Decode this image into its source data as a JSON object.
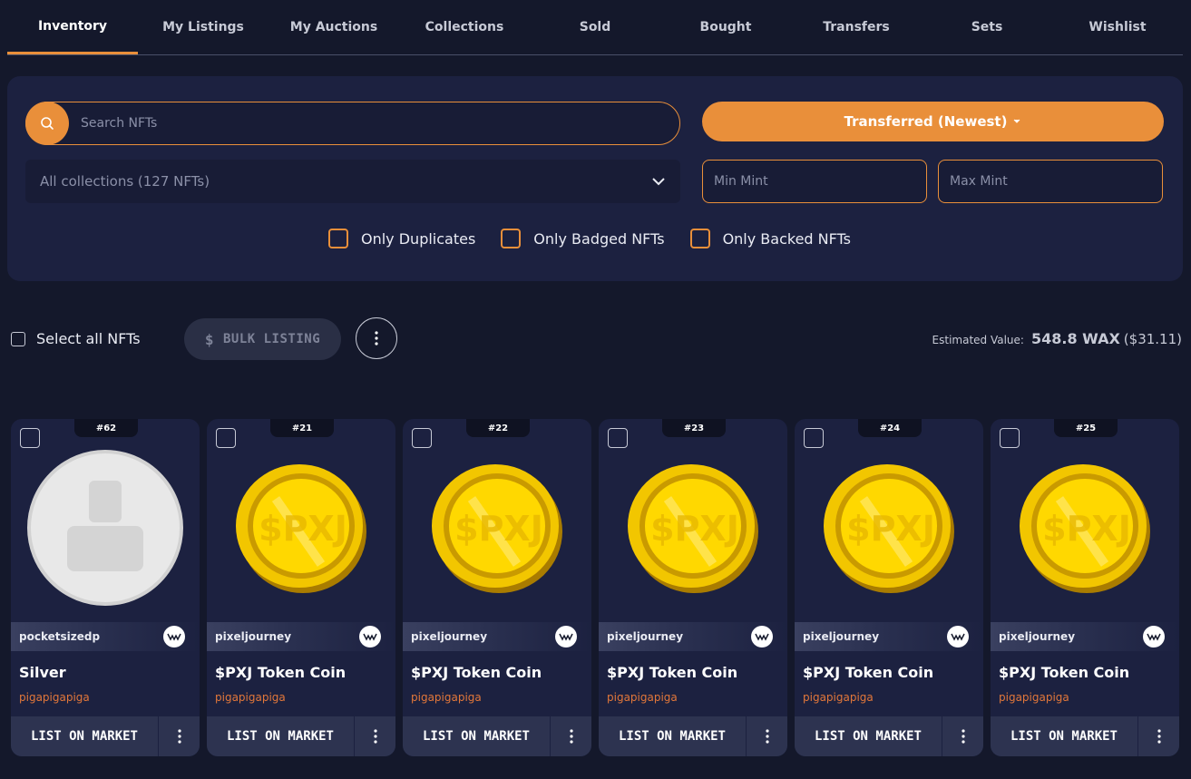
{
  "tabs": [
    "Inventory",
    "My Listings",
    "My Auctions",
    "Collections",
    "Sold",
    "Bought",
    "Transfers",
    "Sets",
    "Wishlist"
  ],
  "active_tab": "Inventory",
  "filters": {
    "search_placeholder": "Search NFTs",
    "sort_label": "Transferred (Newest)",
    "collection_select": "All collections (127 NFTs)",
    "min_mint_placeholder": "Min Mint",
    "max_mint_placeholder": "Max Mint",
    "checkboxes": [
      "Only Duplicates",
      "Only Badged NFTs",
      "Only Backed NFTs"
    ]
  },
  "actions": {
    "select_all": "Select all NFTs",
    "bulk_listing": "BULK LISTING",
    "estimated_label": "Estimated Value:",
    "estimated_wax": "548.8 WAX",
    "estimated_usd": "($31.11)"
  },
  "cards": [
    {
      "mint": "#62",
      "collection": "pocketsizedp",
      "name": "Silver",
      "owner": "pigapigapiga",
      "art": "silver",
      "button": "LIST ON MARKET"
    },
    {
      "mint": "#21",
      "collection": "pixeljourney",
      "name": "$PXJ Token Coin",
      "owner": "pigapigapiga",
      "art": "gold",
      "button": "LIST ON MARKET"
    },
    {
      "mint": "#22",
      "collection": "pixeljourney",
      "name": "$PXJ Token Coin",
      "owner": "pigapigapiga",
      "art": "gold",
      "button": "LIST ON MARKET"
    },
    {
      "mint": "#23",
      "collection": "pixeljourney",
      "name": "$PXJ Token Coin",
      "owner": "pigapigapiga",
      "art": "gold",
      "button": "LIST ON MARKET"
    },
    {
      "mint": "#24",
      "collection": "pixeljourney",
      "name": "$PXJ Token Coin",
      "owner": "pigapigapiga",
      "art": "gold",
      "button": "LIST ON MARKET"
    },
    {
      "mint": "#25",
      "collection": "pixeljourney",
      "name": "$PXJ Token Coin",
      "owner": "pigapigapiga",
      "art": "gold",
      "button": "LIST ON MARKET"
    }
  ],
  "colors": {
    "accent": "#e98f3a",
    "background": "#14182b",
    "panel": "#1c2140",
    "owner": "#e2773a"
  }
}
